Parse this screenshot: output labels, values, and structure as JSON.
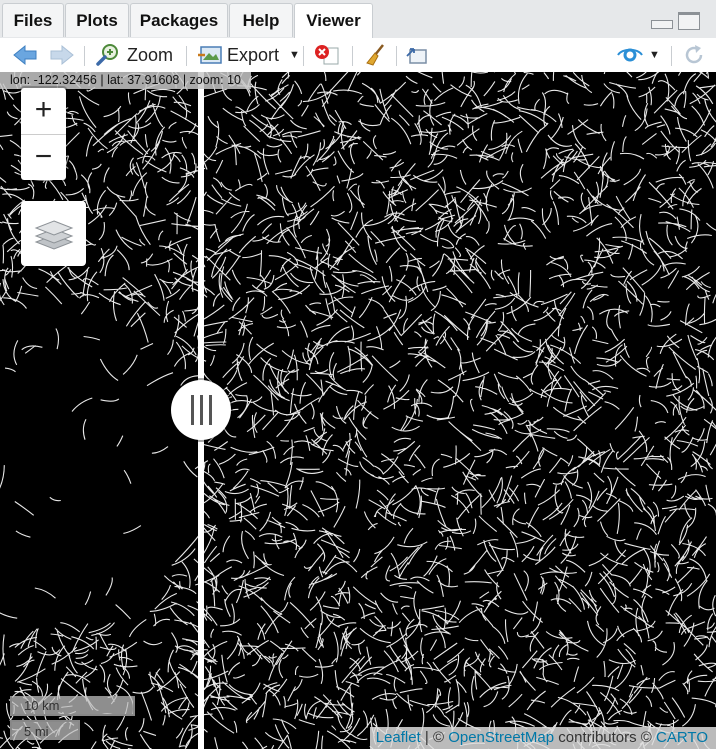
{
  "tabs": [
    "Files",
    "Plots",
    "Packages",
    "Help",
    "Viewer"
  ],
  "toolbar": {
    "zoom_label": "Zoom",
    "export_label": "Export"
  },
  "map": {
    "coords": "lon: -122.32456 | lat: 37.91608 | zoom: 10",
    "zoom_in": "+",
    "zoom_out": "−",
    "scale_km": "10 km",
    "scale_mi": "5 mi",
    "attribution": {
      "leaflet": "Leaflet",
      "sep": " | © ",
      "osm": "OpenStreetMap",
      "contributors": " contributors © ",
      "carto": "CARTO"
    }
  },
  "colors": {
    "accent": "#4a90d9",
    "link": "#0078a8",
    "map_bg": "#000000",
    "edge": "#ffffff"
  },
  "icons": [
    "back-arrow-icon",
    "forward-arrow-icon",
    "zoom-icon",
    "export-icon",
    "remove-icon",
    "broom-icon",
    "popout-icon",
    "publish-icon",
    "refresh-icon",
    "layers-icon"
  ]
}
